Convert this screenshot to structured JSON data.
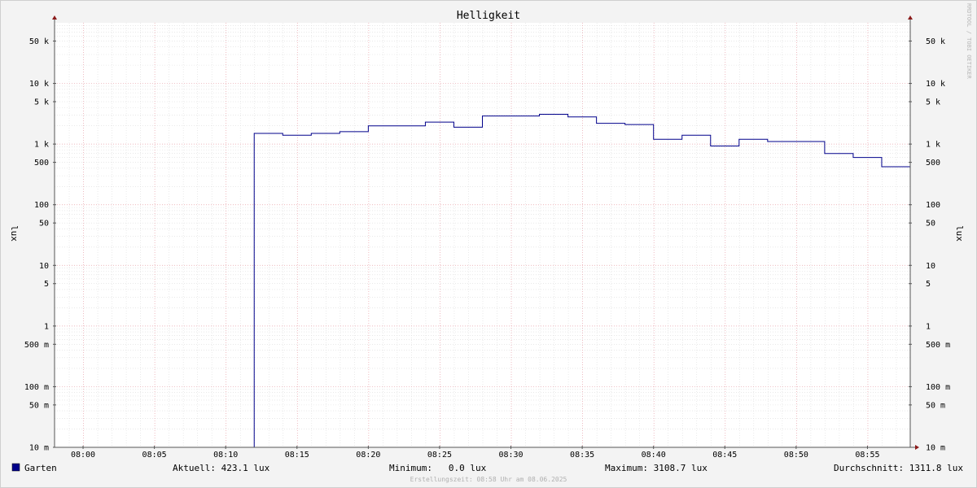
{
  "chart_data": {
    "type": "line",
    "title": "Helligkeit",
    "ylabel": "lux",
    "yscale": "log",
    "ylim": [
      0.01,
      100000
    ],
    "y_ticks": [
      {
        "v": 0.01,
        "label": "10 m"
      },
      {
        "v": 0.05,
        "label": "50 m"
      },
      {
        "v": 0.1,
        "label": "100 m"
      },
      {
        "v": 0.5,
        "label": "500 m"
      },
      {
        "v": 1,
        "label": "1"
      },
      {
        "v": 5,
        "label": "5"
      },
      {
        "v": 10,
        "label": "10"
      },
      {
        "v": 50,
        "label": "50"
      },
      {
        "v": 100,
        "label": "100"
      },
      {
        "v": 500,
        "label": "500"
      },
      {
        "v": 1000,
        "label": "1 k"
      },
      {
        "v": 5000,
        "label": "5 k"
      },
      {
        "v": 10000,
        "label": "10 k"
      },
      {
        "v": 50000,
        "label": "50 k"
      }
    ],
    "x_ticks": [
      "08:00",
      "08:05",
      "08:10",
      "08:15",
      "08:20",
      "08:25",
      "08:30",
      "08:35",
      "08:40",
      "08:45",
      "08:50",
      "08:55"
    ],
    "xlim": [
      "07:58",
      "08:58"
    ],
    "grid": true,
    "series": [
      {
        "name": "Garten",
        "color": "#00008b",
        "step": true,
        "x": [
          "07:58",
          "08:12",
          "08:14",
          "08:16",
          "08:18",
          "08:20",
          "08:24",
          "08:26",
          "08:28",
          "08:32",
          "08:34",
          "08:36",
          "08:38",
          "08:40",
          "08:42",
          "08:44",
          "08:46",
          "08:48",
          "08:50",
          "08:52",
          "08:54",
          "08:56",
          "08:58"
        ],
        "values": [
          0.01,
          1500,
          1400,
          1500,
          1600,
          2000,
          2300,
          1900,
          2900,
          3100,
          2800,
          2200,
          2100,
          1200,
          1400,
          930,
          1200,
          1100,
          1100,
          700,
          600,
          423.1,
          423.1
        ]
      }
    ]
  },
  "legend": {
    "series_name": "Garten",
    "series_color": "#00008b"
  },
  "stats": {
    "current": "Aktuell: 423.1 lux",
    "minimum": "Minimum:   0.0 lux",
    "maximum": "Maximum: 3108.7 lux",
    "average": "Durchschnitt: 1311.8 lux"
  },
  "footer": "Erstellungszeit: 08:58 Uhr am 08.06.2025",
  "watermark": "RRDTOOL / TOBI OETIKER"
}
